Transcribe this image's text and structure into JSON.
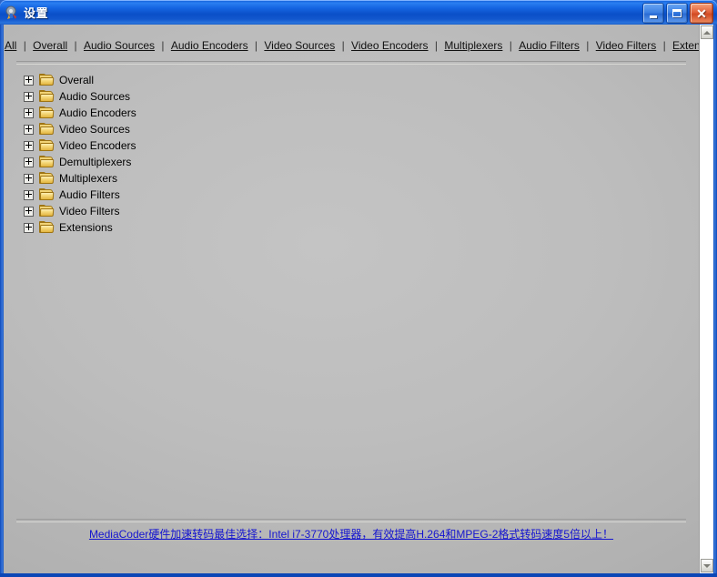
{
  "window": {
    "title": "设置",
    "icon": "mediacoder-app-icon",
    "buttons": {
      "minimize": "minimize-icon",
      "maximize": "maximize-icon",
      "close": "close-icon"
    }
  },
  "quick_links": [
    {
      "label": "All"
    },
    {
      "label": "Overall"
    },
    {
      "label": "Audio Sources"
    },
    {
      "label": "Audio Encoders"
    },
    {
      "label": "Video Sources"
    },
    {
      "label": "Video Encoders"
    },
    {
      "label": "Multiplexers"
    },
    {
      "label": "Audio Filters"
    },
    {
      "label": "Video Filters"
    },
    {
      "label": "Extensions"
    }
  ],
  "link_separator": "|",
  "tree": {
    "nodes": [
      {
        "label": "Overall",
        "expander": "plus",
        "icon": "folder-icon"
      },
      {
        "label": "Audio Sources",
        "expander": "plus",
        "icon": "folder-icon"
      },
      {
        "label": "Audio Encoders",
        "expander": "plus",
        "icon": "folder-icon"
      },
      {
        "label": "Video Sources",
        "expander": "plus",
        "icon": "folder-icon"
      },
      {
        "label": "Video Encoders",
        "expander": "plus",
        "icon": "folder-icon"
      },
      {
        "label": "Demultiplexers",
        "expander": "plus",
        "icon": "folder-icon"
      },
      {
        "label": "Multiplexers",
        "expander": "plus",
        "icon": "folder-icon"
      },
      {
        "label": "Audio Filters",
        "expander": "plus",
        "icon": "folder-icon"
      },
      {
        "label": "Video Filters",
        "expander": "plus",
        "icon": "folder-icon"
      },
      {
        "label": "Extensions",
        "expander": "plus",
        "icon": "folder-icon"
      }
    ]
  },
  "promo": {
    "text": "MediaCoder硬件加速转码最佳选择：Intel i7-3770处理器，有效提高H.264和MPEG-2格式转码速度5倍以上！"
  },
  "scrollbar": {
    "up": "scroll-up-arrow-icon",
    "down": "scroll-down-arrow-icon"
  },
  "colors": {
    "title_bar_blue": "#1666e2",
    "close_button_red": "#d14a22",
    "page_gray": "#bdbdbd",
    "link_text": "#111111",
    "promo_link": "#1414d0",
    "folder_yellow": "#e8bf4d"
  }
}
